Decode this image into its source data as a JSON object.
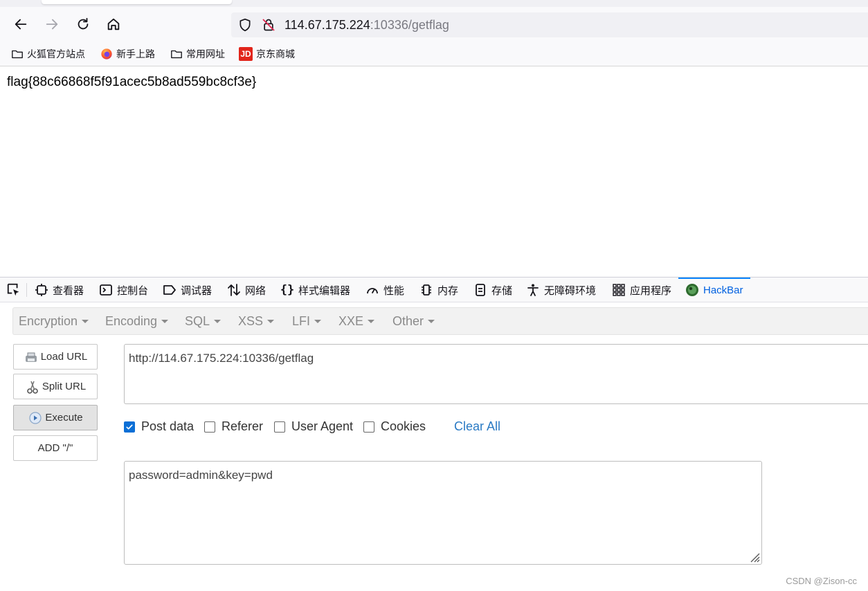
{
  "browser": {
    "url_host": "114.67.175.224",
    "url_rest": ":10336/getflag",
    "bookmarks": [
      {
        "label": "火狐官方站点",
        "icon": "folder-icon"
      },
      {
        "label": "新手上路",
        "icon": "firefox-icon"
      },
      {
        "label": "常用网址",
        "icon": "folder-icon"
      },
      {
        "label": "京东商城",
        "icon": "jd-icon",
        "icon_text": "JD"
      }
    ]
  },
  "page": {
    "flag_text": "flag{88c66868f5f91acec5b8ad559bc8cf3e}"
  },
  "devtools": {
    "tabs": [
      {
        "label": "查看器",
        "icon": "inspector-icon"
      },
      {
        "label": "控制台",
        "icon": "console-icon"
      },
      {
        "label": "调试器",
        "icon": "debugger-icon"
      },
      {
        "label": "网络",
        "icon": "network-icon"
      },
      {
        "label": "样式编辑器",
        "icon": "braces-icon"
      },
      {
        "label": "性能",
        "icon": "performance-icon"
      },
      {
        "label": "内存",
        "icon": "memory-icon"
      },
      {
        "label": "存储",
        "icon": "storage-icon"
      },
      {
        "label": "无障碍环境",
        "icon": "accessibility-icon"
      },
      {
        "label": "应用程序",
        "icon": "application-icon"
      },
      {
        "label": "HackBar",
        "icon": "hackbar-icon",
        "active": true
      }
    ]
  },
  "hackbar": {
    "menu": [
      "Encryption",
      "Encoding",
      "SQL",
      "XSS",
      "LFI",
      "XXE",
      "Other"
    ],
    "buttons": {
      "load_url": "Load URL",
      "split_url": "Split URL",
      "execute": "Execute",
      "add_slash": "ADD \"/\""
    },
    "url_value": "http://114.67.175.224:10336/getflag",
    "options": {
      "post_data": {
        "label": "Post data",
        "checked": true
      },
      "referer": {
        "label": "Referer",
        "checked": false
      },
      "user_agent": {
        "label": "User Agent",
        "checked": false
      },
      "cookies": {
        "label": "Cookies",
        "checked": false
      }
    },
    "clear_all": "Clear All",
    "post_value": "password=admin&key=pwd"
  },
  "watermark": "CSDN @Zison-cc",
  "colors": {
    "accent": "#0a84ff",
    "checkbox_on": "#0b6fd6",
    "link": "#2a7ac4",
    "jd_red": "#e1251b"
  }
}
